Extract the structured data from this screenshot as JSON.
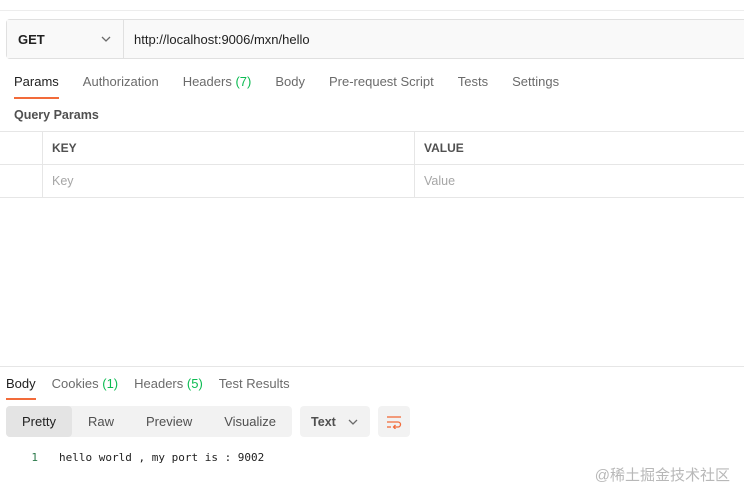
{
  "request": {
    "method": "GET",
    "url": "http://localhost:9006/mxn/hello"
  },
  "request_tabs": [
    {
      "label": "Params",
      "count": "",
      "active": true
    },
    {
      "label": "Authorization",
      "count": "",
      "active": false
    },
    {
      "label": "Headers",
      "count": "(7)",
      "active": false
    },
    {
      "label": "Body",
      "count": "",
      "active": false
    },
    {
      "label": "Pre-request Script",
      "count": "",
      "active": false
    },
    {
      "label": "Tests",
      "count": "",
      "active": false
    },
    {
      "label": "Settings",
      "count": "",
      "active": false
    }
  ],
  "query_params": {
    "title": "Query Params",
    "key_header": "KEY",
    "value_header": "VALUE",
    "key_placeholder": "Key",
    "value_placeholder": "Value"
  },
  "response_tabs": [
    {
      "label": "Body",
      "count": "",
      "active": true
    },
    {
      "label": "Cookies",
      "count": "(1)",
      "active": false
    },
    {
      "label": "Headers",
      "count": "(5)",
      "active": false
    },
    {
      "label": "Test Results",
      "count": "",
      "active": false
    }
  ],
  "response_view": {
    "modes": [
      "Pretty",
      "Raw",
      "Preview",
      "Visualize"
    ],
    "active_mode": "Pretty",
    "format": "Text"
  },
  "response_body": {
    "line_number": "1",
    "text": "hello world , my port is : 9002"
  },
  "watermark": "@稀土掘金技术社区",
  "colors": {
    "accent": "#f26b3a",
    "count_green": "#0cbb52"
  },
  "icons": {
    "method_dropdown": "chevron-down-icon",
    "format_dropdown": "chevron-down-icon",
    "wrap": "wrap-lines-icon"
  }
}
